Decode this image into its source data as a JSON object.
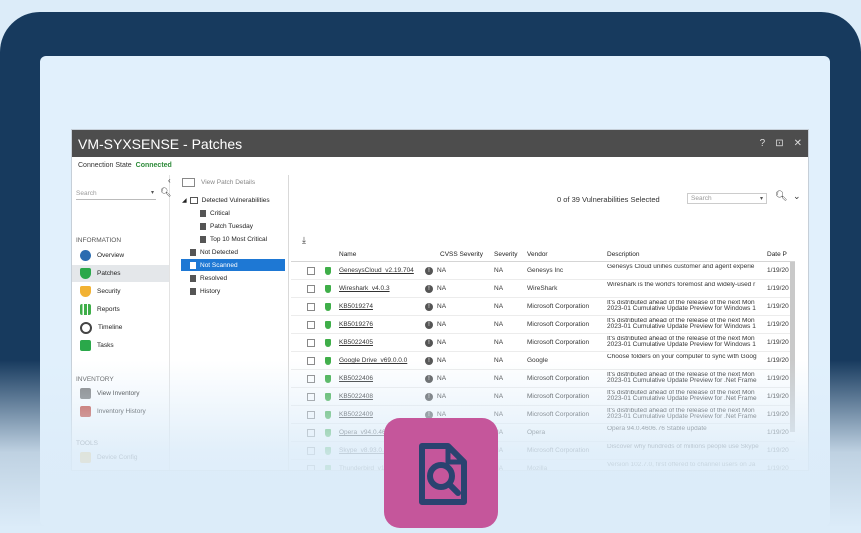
{
  "app": {
    "title": "VM-SYXSENSE - Patches",
    "help": "?",
    "restore": "⊡",
    "close": "✕"
  },
  "connection": {
    "label": "Connection State",
    "status": "Connected"
  },
  "search": {
    "placeholder": "Search"
  },
  "sidebar": {
    "information_label": "INFORMATION",
    "items": [
      {
        "label": "Overview",
        "icon": "pie-chart-icon",
        "color": "#2b6cb0"
      },
      {
        "label": "Patches",
        "icon": "shield-icon",
        "color": "#2aa84a"
      },
      {
        "label": "Security",
        "icon": "lock-shield-icon",
        "color": "#f2b233"
      },
      {
        "label": "Reports",
        "icon": "bar-chart-icon",
        "color": "#3fae49"
      },
      {
        "label": "Timeline",
        "icon": "clock-icon",
        "color": "#444444"
      },
      {
        "label": "Tasks",
        "icon": "tasks-icon",
        "color": "#2aa84a"
      }
    ],
    "inventory_label": "INVENTORY",
    "inventory_items": [
      {
        "label": "View Inventory",
        "icon": "inventory-icon",
        "color": "#7a7a7a"
      },
      {
        "label": "Inventory History",
        "icon": "history-icon",
        "color": "#c0392b"
      }
    ],
    "tools_label": "TOOLS",
    "tools_items": [
      {
        "label": "Device Config",
        "icon": "wrench-icon",
        "color": "#f2b233"
      }
    ]
  },
  "tree": {
    "view_patch_details": "View Patch Details",
    "items": [
      {
        "label": "Detected Vulnerabilities"
      },
      {
        "label": "Critical"
      },
      {
        "label": "Patch Tuesday"
      },
      {
        "label": "Top 10 Most Critical"
      },
      {
        "label": "Not Detected"
      },
      {
        "label": "Not Scanned"
      },
      {
        "label": "Resolved"
      },
      {
        "label": "History"
      }
    ]
  },
  "grid": {
    "selection": "0 of 39 Vulnerabilities Selected",
    "search_placeholder": "Search",
    "columns": [
      "Name",
      "CVSS Severity",
      "Severity",
      "Vendor",
      "Description",
      "Date P"
    ],
    "rows": [
      {
        "name": "GenesysCloud_v2.19.704",
        "cvss": "NA",
        "severity": "NA",
        "vendor": "Genesys Inc",
        "description": "Genesys Cloud unifies customer and agent experie",
        "date": "1/19/20"
      },
      {
        "name": "Wireshark_v4.0.3",
        "cvss": "NA",
        "severity": "NA",
        "vendor": "WireShark",
        "description": "Wireshark is the world's foremost and widely-used r",
        "date": "1/19/20"
      },
      {
        "name": "KB5019274",
        "cvss": "NA",
        "severity": "NA",
        "vendor": "Microsoft Corporation",
        "description": "It's distributed ahead of the release of the next Mon 2023-01 Cumulative Update Preview for Windows 1",
        "date": "1/19/20"
      },
      {
        "name": "KB5019276",
        "cvss": "NA",
        "severity": "NA",
        "vendor": "Microsoft Corporation",
        "description": "It's distributed ahead of the release of the next Mon 2023-01 Cumulative Update Preview for Windows 1",
        "date": "1/19/20"
      },
      {
        "name": "KB5022405",
        "cvss": "NA",
        "severity": "NA",
        "vendor": "Microsoft Corporation",
        "description": "It's distributed ahead of the release of the next Mon 2023-01 Cumulative Update Preview for Windows 1",
        "date": "1/19/20"
      },
      {
        "name": "Google Drive_v69.0.0.0",
        "cvss": "NA",
        "severity": "NA",
        "vendor": "Google",
        "description": "Choose folders on your computer to sync with Goog",
        "date": "1/19/20"
      },
      {
        "name": "KB5022406",
        "cvss": "NA",
        "severity": "NA",
        "vendor": "Microsoft Corporation",
        "description": "It's distributed ahead of the release of the next Mon 2023-01 Cumulative Update Preview for .Net Frame",
        "date": "1/19/20"
      },
      {
        "name": "KB5022408",
        "cvss": "NA",
        "severity": "NA",
        "vendor": "Microsoft Corporation",
        "description": "It's distributed ahead of the release of the next Mon 2023-01 Cumulative Update Preview for .Net Frame",
        "date": "1/19/20"
      },
      {
        "name": "KB5022409",
        "cvss": "NA",
        "severity": "NA",
        "vendor": "Microsoft Corporation",
        "description": "It's distributed ahead of the release of the next Mon 2023-01 Cumulative Update Preview for .Net Frame",
        "date": "1/19/20"
      },
      {
        "name": "Opera_v94.0.4606.76",
        "cvss": "NA",
        "severity": "NA",
        "vendor": "Opera",
        "description": "Opera 94.0.4606.76 Stable update",
        "date": "1/19/20"
      },
      {
        "name": "Skype_v8.93.0.41",
        "cvss": "NA",
        "severity": "NA",
        "vendor": "Microsoft Corporation",
        "description": "Discover why hundreds of millions people use Skype",
        "date": "1/19/20"
      },
      {
        "name": "Thunderbird_v102.7.0",
        "cvss": "NA",
        "severity": "NA",
        "vendor": "Mozilla",
        "description": "Version 102.7.0, first offered to channel users on Ja",
        "date": "1/19/20"
      }
    ]
  },
  "colors": {
    "frame": "#173a5e",
    "background": "#dcecf9",
    "titlebar": "#4d4d4d",
    "selection": "#1e78d4",
    "accent_pink": "#c5569b",
    "connected": "#2e8b3a"
  },
  "app_icon": "document-search-icon"
}
